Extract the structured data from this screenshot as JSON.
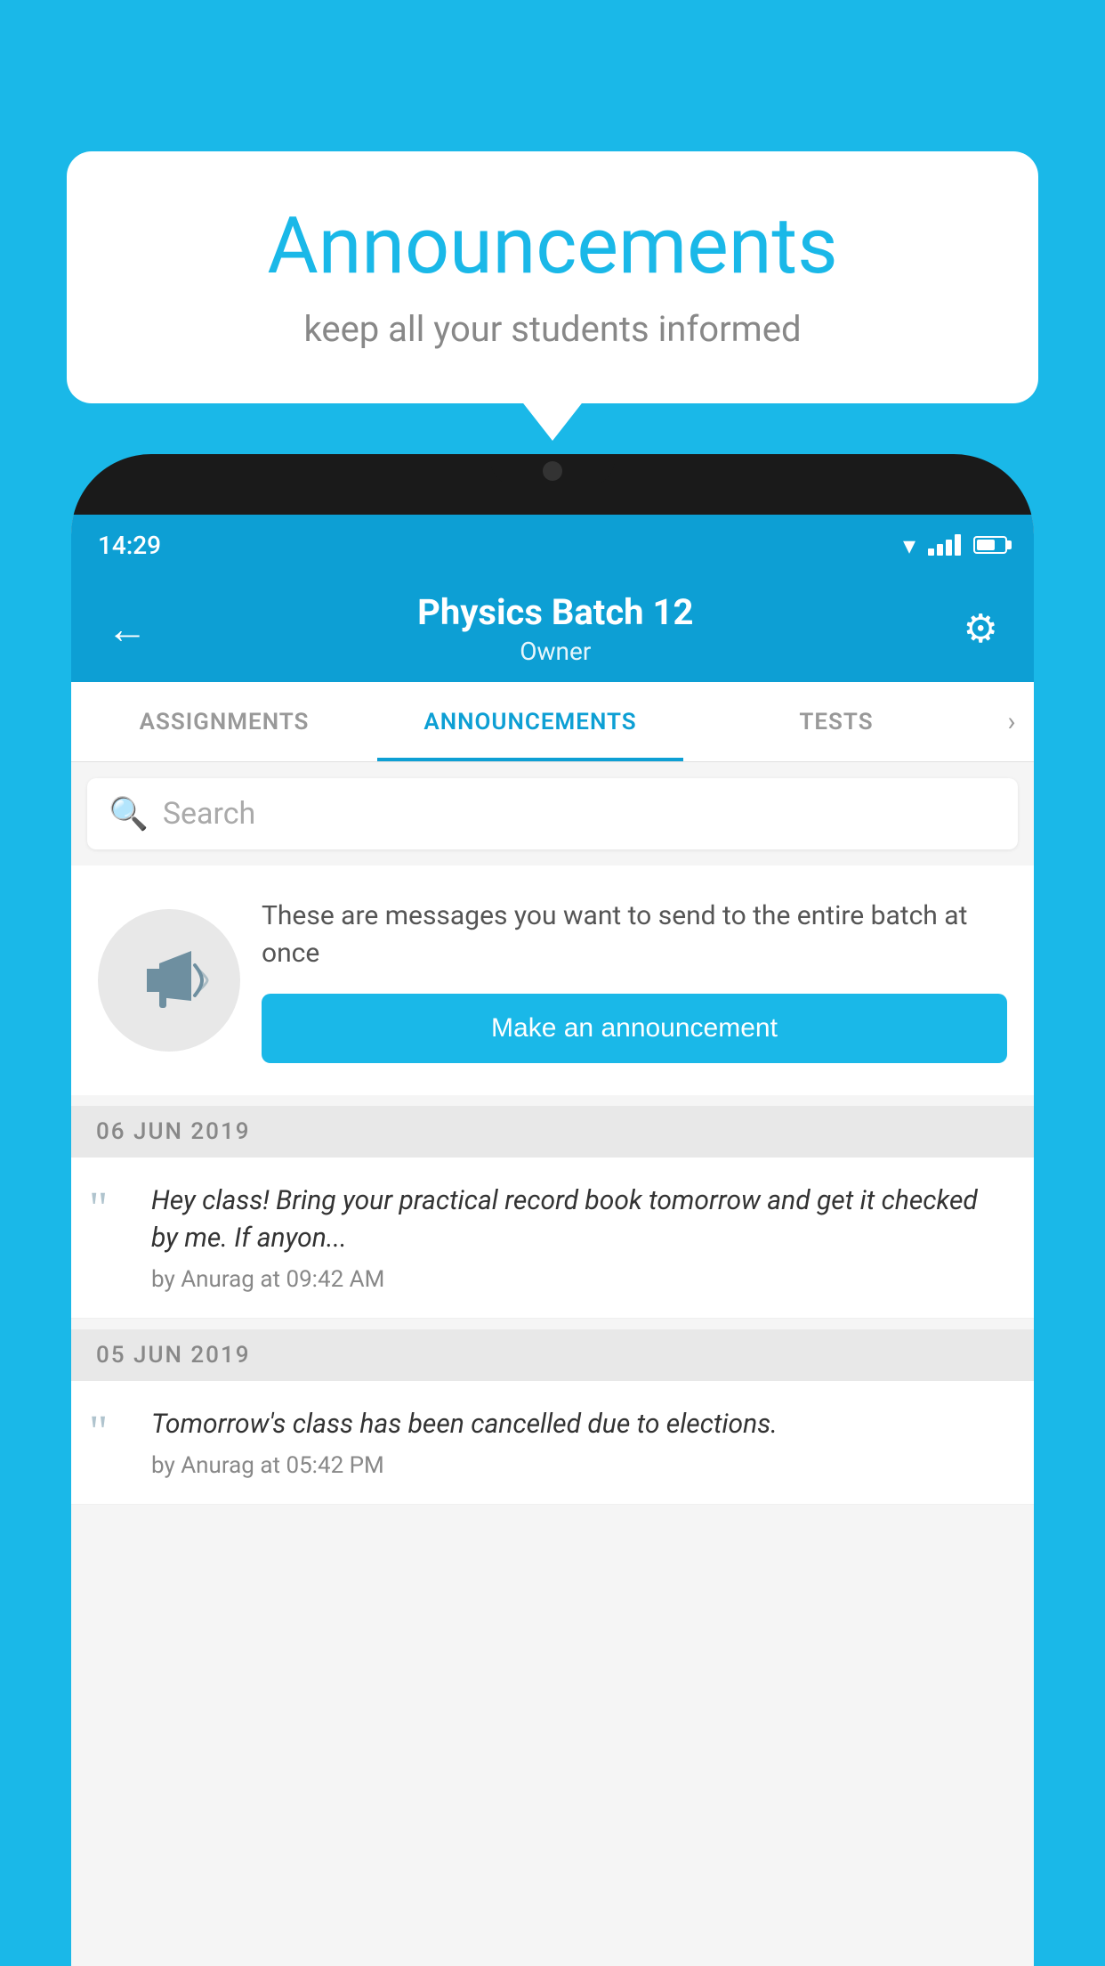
{
  "background_color": "#1ab8e8",
  "speech_bubble": {
    "title": "Announcements",
    "subtitle": "keep all your students informed"
  },
  "status_bar": {
    "time": "14:29"
  },
  "app_bar": {
    "title": "Physics Batch 12",
    "subtitle": "Owner",
    "back_label": "←",
    "settings_label": "⚙"
  },
  "tabs": [
    {
      "label": "ASSIGNMENTS",
      "active": false
    },
    {
      "label": "ANNOUNCEMENTS",
      "active": true
    },
    {
      "label": "TESTS",
      "active": false
    }
  ],
  "search": {
    "placeholder": "Search"
  },
  "promo": {
    "description": "These are messages you want to send to the entire batch at once",
    "button_label": "Make an announcement"
  },
  "announcements": [
    {
      "date": "06  JUN  2019",
      "text": "Hey class! Bring your practical record book tomorrow and get it checked by me. If anyon...",
      "meta": "by Anurag at 09:42 AM"
    },
    {
      "date": "05  JUN  2019",
      "text": "Tomorrow's class has been cancelled due to elections.",
      "meta": "by Anurag at 05:42 PM"
    }
  ]
}
